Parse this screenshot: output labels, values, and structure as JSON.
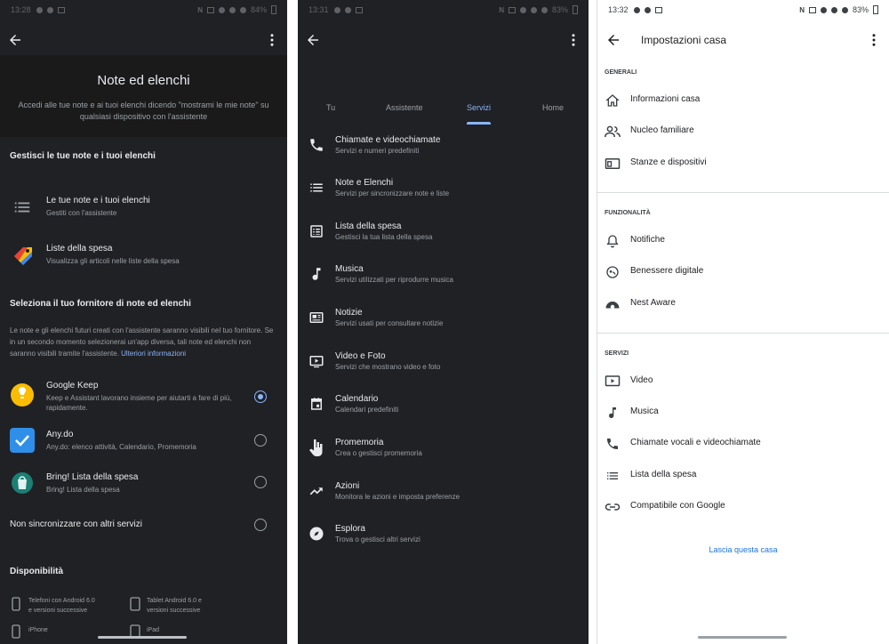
{
  "panel_notes": {
    "status": {
      "time": "13:28",
      "battery": "84%"
    },
    "title": "Note ed elenchi",
    "description": "Accedi alle tue note e ai tuoi elenchi dicendo \"mostrami le mie note\" su qualsiasi dispositivo con l'assistente",
    "section_manage": "Gestisci le tue note e i tuoi elenchi",
    "manage_items": [
      {
        "title": "Le tue note e i tuoi elenchi",
        "subtitle": "Gestiti con l'assistente"
      },
      {
        "title": "Liste della spesa",
        "subtitle": "Visualizza gli articoli nelle liste della spesa"
      }
    ],
    "section_provider": "Seleziona il tuo fornitore di note ed elenchi",
    "provider_info": "Le note e gli elenchi futuri creati con l'assistente saranno visibili nel tuo fornitore. Se in un secondo momento selezionerai un'app diversa, tali note ed elenchi non saranno visibili tramite l'assistente.",
    "provider_info_link": "Ulteriori informazioni",
    "providers": [
      {
        "title": "Google Keep",
        "subtitle": "Keep e Assistant lavorano insieme per aiutarti a fare di più, rapidamente.",
        "selected": true
      },
      {
        "title": "Any.do",
        "subtitle": "Any.do: elenco attività, Calendario, Promemoria",
        "selected": false
      },
      {
        "title": "Bring! Lista della spesa",
        "subtitle": "Bring! Lista della spesa",
        "selected": false
      }
    ],
    "no_sync": "Non sincronizzare con altri servizi",
    "section_availability": "Disponibilità",
    "availability": [
      {
        "line1": "Telefoni con Android 6.0",
        "line2": "e versioni successive"
      },
      {
        "line1": "Tablet Android 6.0 e",
        "line2": "versioni successive"
      },
      {
        "line1": "iPhone",
        "line2": ""
      },
      {
        "line1": "iPad",
        "line2": ""
      }
    ]
  },
  "panel_services": {
    "status": {
      "time": "13:31",
      "battery": "83%"
    },
    "tabs": [
      "Tu",
      "Assistente",
      "Servizi",
      "Home"
    ],
    "active_tab": "Servizi",
    "services": [
      {
        "title": "Chiamate e videochiamate",
        "subtitle": "Servizi e numeri predefiniti",
        "icon": "phone-icon"
      },
      {
        "title": "Note e Elenchi",
        "subtitle": "Servizi per sincronizzare note e liste",
        "icon": "list-icon"
      },
      {
        "title": "Lista della spesa",
        "subtitle": "Gestisci la tua lista della spesa",
        "icon": "checklist-icon"
      },
      {
        "title": "Musica",
        "subtitle": "Servizi utilizzati per riprodurre musica",
        "icon": "music-note-icon"
      },
      {
        "title": "Notizie",
        "subtitle": "Servizi usati per consultare notizie",
        "icon": "news-icon"
      },
      {
        "title": "Video e Foto",
        "subtitle": "Servizi che mostrano video e foto",
        "icon": "video-icon"
      },
      {
        "title": "Calendario",
        "subtitle": "Calendari predefiniti",
        "icon": "calendar-icon"
      },
      {
        "title": "Promemoria",
        "subtitle": "Crea o gestisci promemoria",
        "icon": "reminder-hand-icon"
      },
      {
        "title": "Azioni",
        "subtitle": "Monitora le azioni e imposta preferenze",
        "icon": "trending-icon"
      },
      {
        "title": "Esplora",
        "subtitle": "Trova o gestisci altri servizi",
        "icon": "compass-icon"
      }
    ]
  },
  "panel_home": {
    "status": {
      "time": "13:32",
      "battery": "83%"
    },
    "title": "Impostazioni casa",
    "groups": [
      {
        "label": "GENERALI",
        "items": [
          {
            "label": "Informazioni casa",
            "icon": "home-icon"
          },
          {
            "label": "Nucleo familiare",
            "icon": "people-icon"
          },
          {
            "label": "Stanze e dispositivi",
            "icon": "devices-icon"
          }
        ]
      },
      {
        "label": "FUNZIONALITÀ",
        "items": [
          {
            "label": "Notifiche",
            "icon": "bell-icon"
          },
          {
            "label": "Benessere digitale",
            "icon": "wellbeing-icon"
          },
          {
            "label": "Nest Aware",
            "icon": "nest-aware-icon"
          }
        ]
      },
      {
        "label": "SERVIZI",
        "items": [
          {
            "label": "Video",
            "icon": "video-icon"
          },
          {
            "label": "Musica",
            "icon": "music-note-icon"
          },
          {
            "label": "Chiamate vocali e videochiamate",
            "icon": "phone-icon"
          },
          {
            "label": "Lista della spesa",
            "icon": "list-icon"
          },
          {
            "label": "Compatibile con Google",
            "icon": "link-icon"
          }
        ]
      }
    ],
    "leave_home": "Lascia questa casa"
  },
  "colors": {
    "dark_bg": "#202124",
    "accent_blue_dark": "#8ab4f8",
    "accent_blue_light": "#1a73e8",
    "keep_yellow": "#fbbc04",
    "anydo_blue": "#2f8fe8",
    "bring_teal": "#1b7f74"
  }
}
